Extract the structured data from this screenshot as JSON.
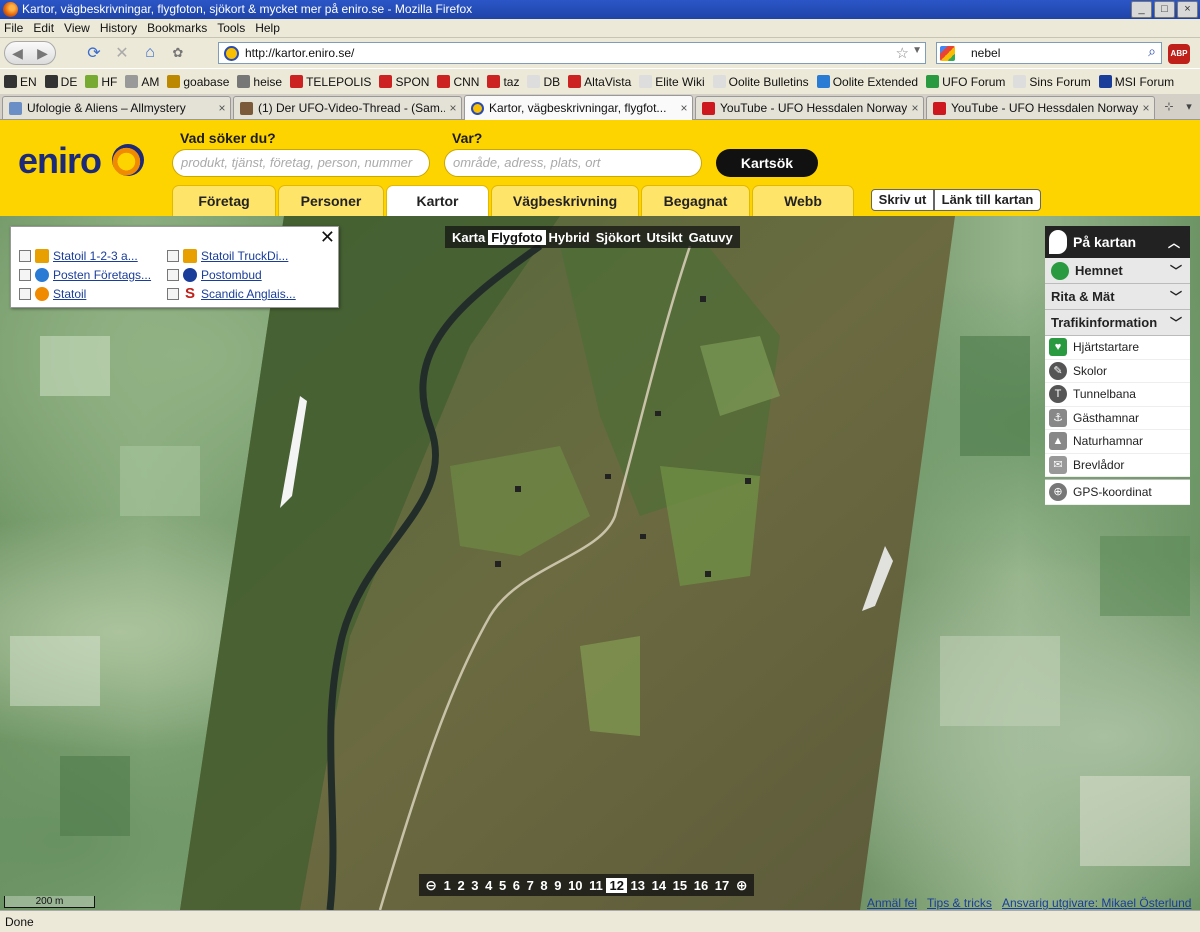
{
  "window": {
    "title": "Kartor, vägbeskrivningar, flygfoton, sjökort & mycket mer på eniro.se - Mozilla Firefox"
  },
  "menu": [
    "File",
    "Edit",
    "View",
    "History",
    "Bookmarks",
    "Tools",
    "Help"
  ],
  "address": {
    "url": "http://kartor.eniro.se/"
  },
  "search": {
    "value": "nebel"
  },
  "bookmarks": [
    "EN",
    "DE",
    "HF",
    "AM",
    "goabase",
    "heise",
    "TELEPOLIS",
    "SPON",
    "CNN",
    "taz",
    "DB",
    "AltaVista",
    "Elite Wiki",
    "Oolite Bulletins",
    "Oolite Extended",
    "UFO Forum",
    "Sins Forum",
    "MSI Forum"
  ],
  "tabs": [
    {
      "label": "Ufologie & Aliens – Allmystery"
    },
    {
      "label": "(1) Der UFO-Video-Thread - (Sam..."
    },
    {
      "label": "Kartor, vägbeskrivningar, flygfot..."
    },
    {
      "label": "YouTube - UFO Hessdalen Norway..."
    },
    {
      "label": "YouTube - UFO Hessdalen Norway..."
    }
  ],
  "eniro": {
    "logo": "eniro",
    "what_label": "Vad söker du?",
    "what_placeholder": "produkt, tjänst, företag, person, nummer",
    "where_label": "Var?",
    "where_placeholder": "område, adress, plats, ort",
    "search_button": "Kartsök",
    "tabs": [
      "Företag",
      "Personer",
      "Kartor",
      "Vägbeskrivning",
      "Begagnat",
      "Webb"
    ],
    "print_button": "Skriv ut",
    "link_button": "Länk till kartan"
  },
  "map": {
    "types": [
      "Karta",
      "Flygfoto",
      "Hybrid",
      "Sjökort",
      "Utsikt",
      "Gatuvy"
    ],
    "active_type": "Flygfoto",
    "pois": [
      {
        "label": "Statoil 1-2-3 a...",
        "icon_color": "#e8a000"
      },
      {
        "label": "Posten Företags...",
        "icon_color": "#2a7bd4"
      },
      {
        "label": "Statoil",
        "icon_color": "#f08a00"
      },
      {
        "label": "Statoil TruckDi...",
        "icon_color": "#e8a000"
      },
      {
        "label": "Postombud",
        "icon_color": "#1a3d9a"
      },
      {
        "label": "Scandic Anglais...",
        "icon_color": "#c0201a"
      }
    ],
    "zoom_levels": [
      "1",
      "2",
      "3",
      "4",
      "5",
      "6",
      "7",
      "8",
      "9",
      "10",
      "11",
      "12",
      "13",
      "14",
      "15",
      "16",
      "17"
    ],
    "zoom_active": "12",
    "scale": "200 m"
  },
  "right_panel": {
    "title": "På kartan",
    "sections": [
      "Hemnet",
      "Rita & Mät",
      "Trafikinformation"
    ],
    "items": [
      "Hjärtstartare",
      "Skolor",
      "Tunnelbana",
      "Gästhamnar",
      "Naturhamnar",
      "Brevlådor"
    ],
    "gps": "GPS-koordinat"
  },
  "footer": {
    "links": [
      "Anmäl fel",
      "Tips & tricks",
      "Ansvarig utgivare: Mikael Österlund"
    ]
  },
  "status": "Done"
}
